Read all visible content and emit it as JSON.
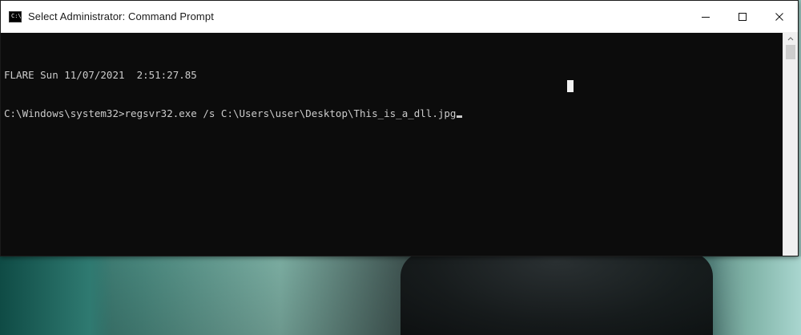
{
  "window": {
    "title": "Select Administrator: Command Prompt",
    "icon_text": "C:\\",
    "icon_name": "cmd-icon"
  },
  "controls": {
    "minimize_icon": "minimize-icon",
    "maximize_icon": "maximize-icon",
    "close_icon": "close-icon"
  },
  "console": {
    "line1": "FLARE Sun 11/07/2021  2:51:27.85",
    "line2_prefix": "C:\\Windows\\system32>",
    "line2_command": "regsvr32.exe /s C:\\Users\\user\\Desktop\\This_is_a_dll.jpg"
  },
  "colors": {
    "console_bg": "#0c0c0c",
    "console_text": "#cccccc",
    "titlebar_bg": "#ffffff"
  }
}
